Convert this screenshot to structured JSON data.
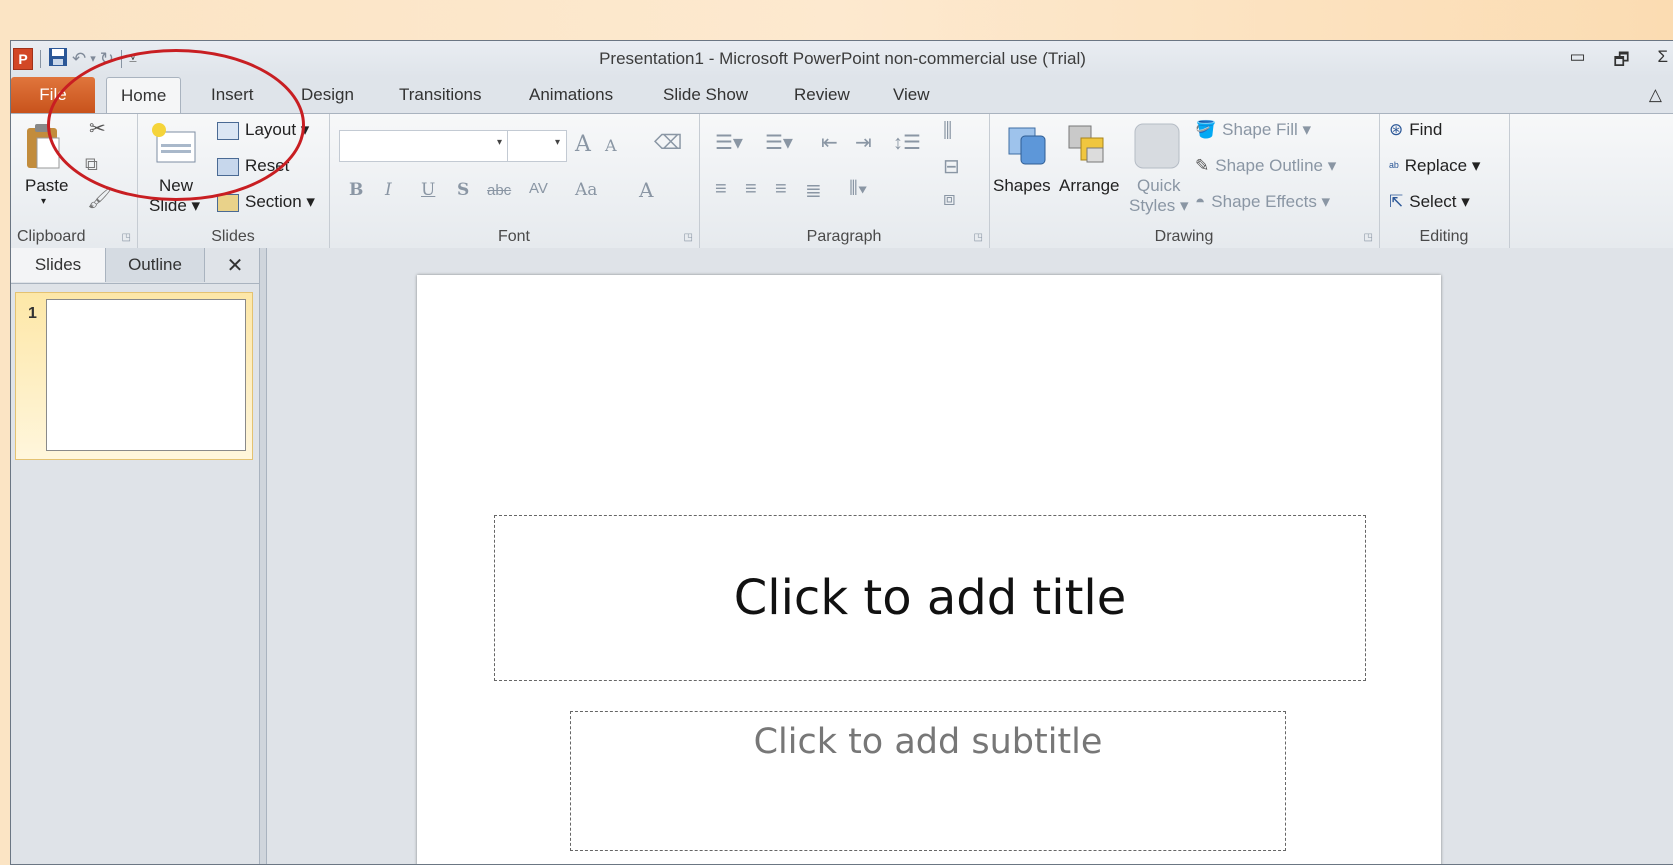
{
  "window": {
    "title": "Presentation1  -  Microsoft PowerPoint non-commercial use (Trial)",
    "app_icon": "P",
    "minimize_glyph": "▭",
    "restore_glyph": "🗗",
    "close_glyph": "Σ"
  },
  "tabs": {
    "file": "File",
    "items": [
      "Home",
      "Insert",
      "Design",
      "Transitions",
      "Animations",
      "Slide Show",
      "Review",
      "View"
    ],
    "active": "Home",
    "help_glyph": "△"
  },
  "ribbon": {
    "clipboard": {
      "label": "Clipboard",
      "paste": "Paste"
    },
    "slides": {
      "label": "Slides",
      "new_slide_line1": "New",
      "new_slide_line2": "Slide ▾",
      "layout": "Layout ▾",
      "reset": "Reset",
      "section": "Section ▾"
    },
    "font": {
      "label": "Font",
      "bold": "B",
      "italic": "I",
      "underline": "U",
      "shadow": "S",
      "strike": "abc",
      "spacing": "AV",
      "case": "Aa",
      "grow": "A",
      "shrink": "A",
      "color": "A"
    },
    "paragraph": {
      "label": "Paragraph"
    },
    "drawing": {
      "label": "Drawing",
      "shapes": "Shapes",
      "arrange": "Arrange",
      "quick_line1": "Quick",
      "quick_line2": "Styles ▾",
      "shape_fill": "Shape Fill ▾",
      "shape_outline": "Shape Outline ▾",
      "shape_effects": "Shape Effects ▾"
    },
    "editing": {
      "label": "Editing",
      "find": "Find",
      "replace": "Replace ▾",
      "select": "Select ▾"
    }
  },
  "pane": {
    "tab_slides": "Slides",
    "tab_outline": "Outline",
    "close_glyph": "✕",
    "slide_number": "1"
  },
  "slide": {
    "title_placeholder": "Click to add title",
    "subtitle_placeholder": "Click to add subtitle"
  },
  "colors": {
    "file_tab": "#d25a20",
    "annotation": "#c81e22"
  }
}
